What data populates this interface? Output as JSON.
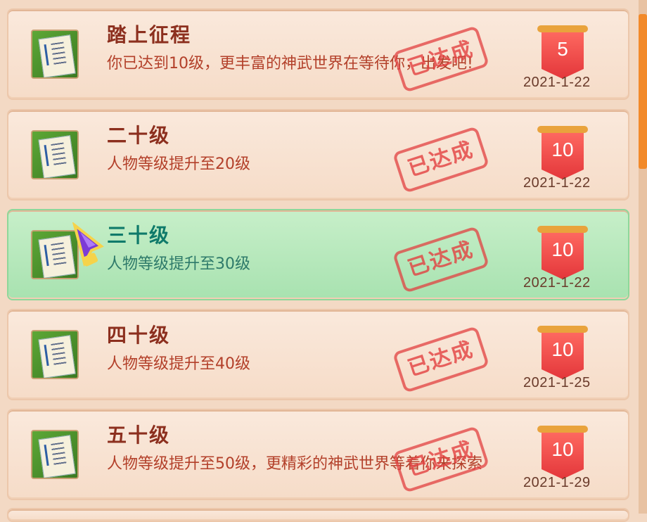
{
  "items": [
    {
      "title": "踏上征程",
      "desc": "你已达到10级，更丰富的神武世界在等待你，出发吧!",
      "stamp": "已达成",
      "reward": "5",
      "date": "2021-1-22",
      "selected": false
    },
    {
      "title": "二十级",
      "desc": "人物等级提升至20级",
      "stamp": "已达成",
      "reward": "10",
      "date": "2021-1-22",
      "selected": false
    },
    {
      "title": "三十级",
      "desc": "人物等级提升至30级",
      "stamp": "已达成",
      "reward": "10",
      "date": "2021-1-22",
      "selected": true
    },
    {
      "title": "四十级",
      "desc": "人物等级提升至40级",
      "stamp": "已达成",
      "reward": "10",
      "date": "2021-1-25",
      "selected": false
    },
    {
      "title": "五十级",
      "desc": "人物等级提升至50级，更精彩的神武世界等着你来探索",
      "stamp": "已达成",
      "reward": "10",
      "date": "2021-1-29",
      "selected": false
    }
  ],
  "icons": {
    "achievement": "scroll-book-icon",
    "reward": "ribbon-badge-icon",
    "cursor": "crystal-pointer-icon"
  }
}
